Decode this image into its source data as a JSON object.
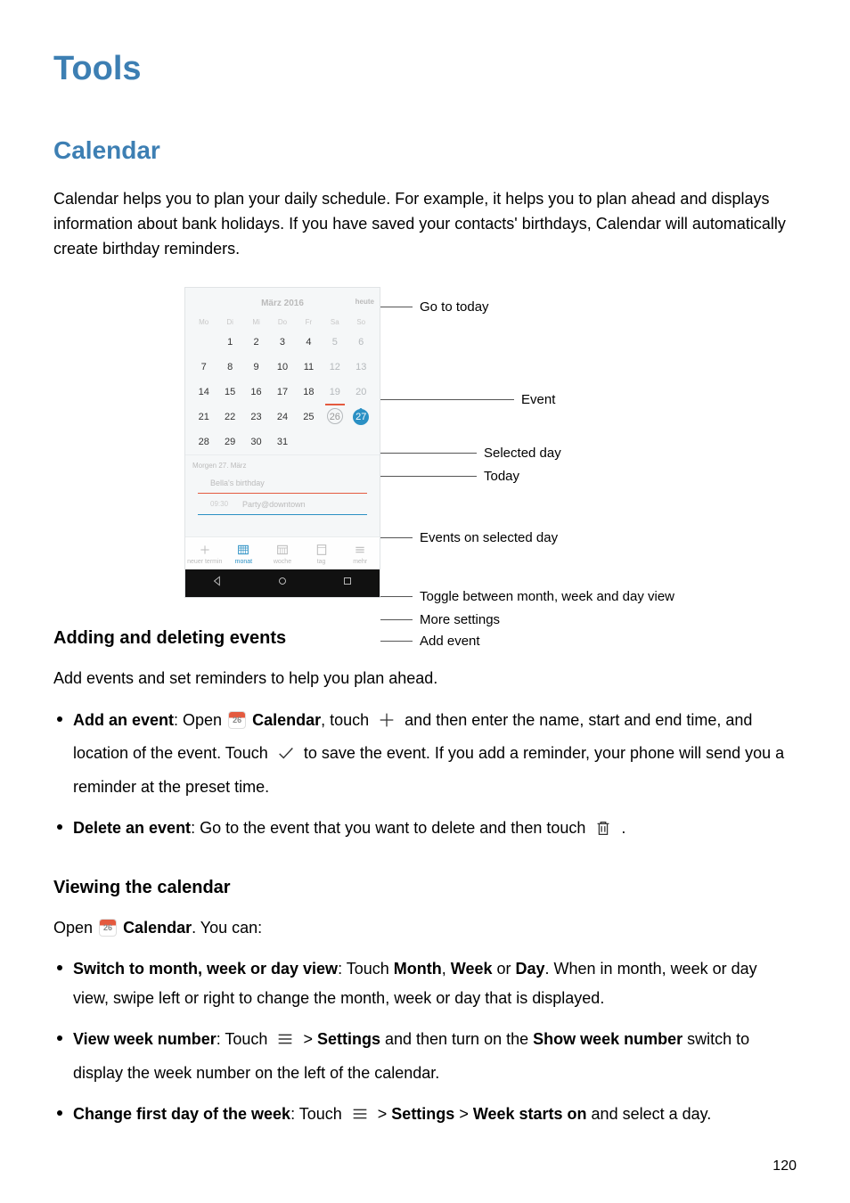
{
  "page_title": "Tools",
  "section_title": "Calendar",
  "intro": "Calendar helps you to plan your daily schedule. For example, it helps you to plan ahead and displays information about bank holidays. If you have saved your contacts' birthdays, Calendar will automatically create birthday reminders.",
  "diagram": {
    "header": "März 2016",
    "today_link": "heute",
    "dow": [
      "Mo",
      "Di",
      "Mi",
      "Do",
      "Fr",
      "Sa",
      "So"
    ],
    "weeks": [
      [
        {
          "n": "",
          "dim": true
        },
        {
          "n": "1"
        },
        {
          "n": "2"
        },
        {
          "n": "3"
        },
        {
          "n": "4"
        },
        {
          "n": "5",
          "dim": true
        },
        {
          "n": "6",
          "dim": true
        }
      ],
      [
        {
          "n": "7"
        },
        {
          "n": "8"
        },
        {
          "n": "9"
        },
        {
          "n": "10"
        },
        {
          "n": "11"
        },
        {
          "n": "12",
          "dim": true
        },
        {
          "n": "13",
          "dim": true
        }
      ],
      [
        {
          "n": "14"
        },
        {
          "n": "15"
        },
        {
          "n": "16"
        },
        {
          "n": "17"
        },
        {
          "n": "18"
        },
        {
          "n": "19",
          "dim": true,
          "event": true
        },
        {
          "n": "20",
          "dim": true
        }
      ],
      [
        {
          "n": "21"
        },
        {
          "n": "22"
        },
        {
          "n": "23"
        },
        {
          "n": "24"
        },
        {
          "n": "25"
        },
        {
          "n": "26",
          "dim": true,
          "today": true
        },
        {
          "n": "27",
          "dim": true,
          "selected": true,
          "dot": true
        }
      ],
      [
        {
          "n": "28"
        },
        {
          "n": "29"
        },
        {
          "n": "30"
        },
        {
          "n": "31"
        },
        {
          "n": ""
        },
        {
          "n": ""
        },
        {
          "n": ""
        }
      ]
    ],
    "agenda_header": "Morgen 27. März",
    "agenda": [
      {
        "time": "",
        "text": "Bella's birthday"
      },
      {
        "time": "09:30",
        "text": "Party@downtown"
      }
    ],
    "tabs": [
      {
        "label": "neuer termin",
        "icon": "plus"
      },
      {
        "label": "monat",
        "icon": "month",
        "active": true
      },
      {
        "label": "woche",
        "icon": "week"
      },
      {
        "label": "tag",
        "icon": "day"
      },
      {
        "label": "mehr",
        "icon": "menu"
      }
    ],
    "labels": {
      "go_to_today": "Go to today",
      "event": "Event",
      "selected_day": "Selected day",
      "today": "Today",
      "events_on_selected": "Events on selected day",
      "toggle": "Toggle between month, week and day view",
      "more_settings": "More settings",
      "add_event": "Add event"
    }
  },
  "sub1_title": "Adding and deleting events",
  "sub1_intro": "Add events and set reminders to help you plan ahead.",
  "bullets1": {
    "add_label": "Add an event",
    "add_1": ": Open ",
    "add_cal": "Calendar",
    "add_2": ", touch ",
    "add_3": " and then enter the name, start and end time, and location of the event. Touch ",
    "add_4": " to save the event. If you add a reminder, your phone will send you a reminder at the preset time.",
    "del_label": "Delete an event",
    "del_1": ": Go to the event that you want to delete and then touch ",
    "del_2": " ."
  },
  "sub2_title": "Viewing the calendar",
  "sub2_intro_1": "Open ",
  "sub2_intro_cal": "Calendar",
  "sub2_intro_2": ". You can:",
  "bullets2": {
    "b1_label": "Switch to month, week or day view",
    "b1_1": ": Touch ",
    "b1_m": "Month",
    "b1_c1": ", ",
    "b1_w": "Week",
    "b1_c2": " or ",
    "b1_d": "Day",
    "b1_2": ". When in month, week or day view, swipe left or right to change the month, week or day that is displayed.",
    "b2_label": "View week number",
    "b2_1": ": Touch ",
    "b2_2": " > ",
    "b2_settings": "Settings",
    "b2_3": " and then turn on the ",
    "b2_switch": "Show week number",
    "b2_4": " switch to display the week number on the left of the calendar.",
    "b3_label": "Change first day of the week",
    "b3_1": ": Touch ",
    "b3_2": " > ",
    "b3_settings": "Settings",
    "b3_3": " > ",
    "b3_wso": "Week starts on",
    "b3_4": " and select a day."
  },
  "page_number": "120"
}
